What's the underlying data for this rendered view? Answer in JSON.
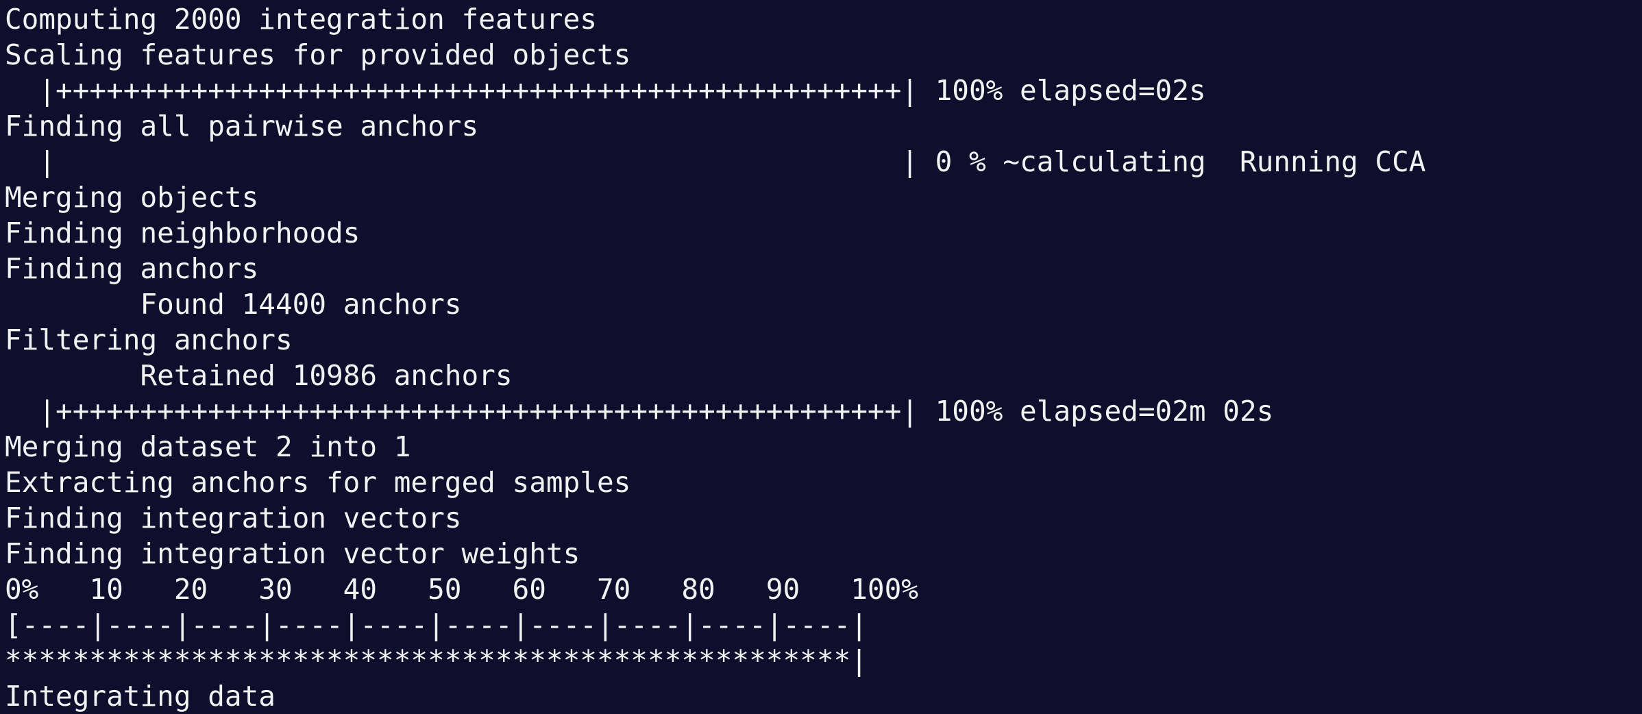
{
  "terminal": {
    "lines": [
      "Computing 2000 integration features",
      "Scaling features for provided objects",
      "  |++++++++++++++++++++++++++++++++++++++++++++++++++| 100% elapsed=02s",
      "Finding all pairwise anchors",
      "  |                                                  | 0 % ~calculating  Running CCA",
      "Merging objects",
      "Finding neighborhoods",
      "Finding anchors",
      "\tFound 14400 anchors",
      "Filtering anchors",
      "\tRetained 10986 anchors",
      "  |++++++++++++++++++++++++++++++++++++++++++++++++++| 100% elapsed=02m 02s",
      "Merging dataset 2 into 1",
      "Extracting anchors for merged samples",
      "Finding integration vectors",
      "Finding integration vector weights",
      "0%   10   20   30   40   50   60   70   80   90   100%",
      "[----|----|----|----|----|----|----|----|----|----|",
      "**************************************************|",
      "Integrating data"
    ],
    "colors": {
      "background": "#0f0f2d",
      "foreground": "#f2f2f2"
    }
  }
}
